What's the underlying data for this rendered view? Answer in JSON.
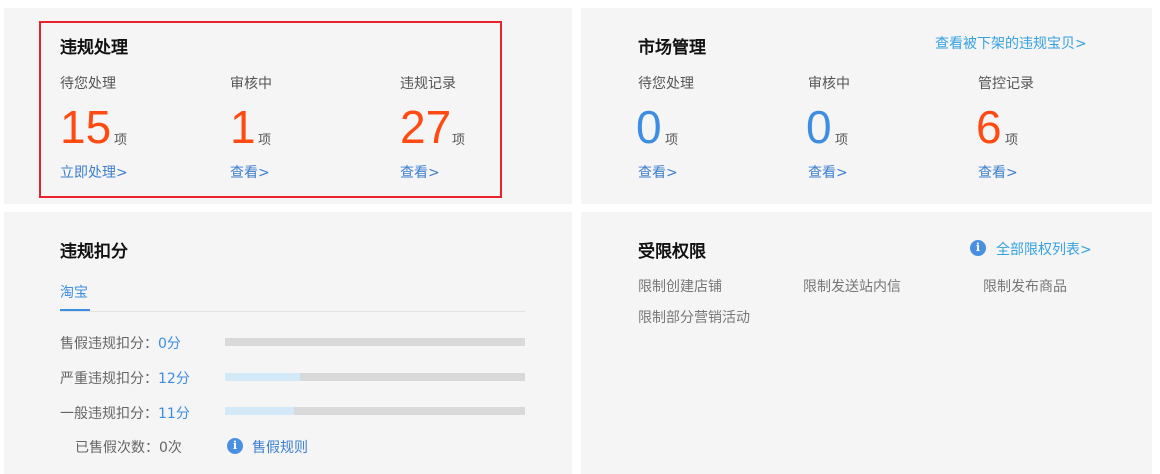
{
  "violation": {
    "title": "违规处理",
    "unit": "项",
    "stats": [
      {
        "label": "待您处理",
        "value": "15",
        "link": "立即处理>"
      },
      {
        "label": "审核中",
        "value": "1",
        "link": "查看>"
      },
      {
        "label": "违规记录",
        "value": "27",
        "link": "查看>"
      }
    ]
  },
  "market": {
    "title": "市场管理",
    "top_link": "查看被下架的违规宝贝>",
    "unit": "项",
    "stats": [
      {
        "label": "待您处理",
        "value": "0",
        "link": "查看>"
      },
      {
        "label": "审核中",
        "value": "0",
        "link": "查看>"
      },
      {
        "label": "管控记录",
        "value": "6",
        "link": "查看>"
      }
    ]
  },
  "deduct": {
    "title": "违规扣分",
    "tab": "淘宝",
    "rows": [
      {
        "label": "售假违规扣分：",
        "value": "0分",
        "fill": 0
      },
      {
        "label": "严重违规扣分：",
        "value": "12分",
        "fill": 0.25
      },
      {
        "label": "一般违规扣分：",
        "value": "11分",
        "fill": 0.23
      }
    ],
    "fake_count_label": "已售假次数：",
    "fake_count_value": "0次",
    "rule_link": "售假规则"
  },
  "restrict": {
    "title": "受限权限",
    "all_link": "全部限权列表>",
    "items": [
      "限制创建店铺",
      "限制发送站内信",
      "限制发布商品",
      "限制部分营销活动"
    ]
  },
  "colors": {
    "accent_red": "#ff4a12",
    "accent_blue": "#3d8de3",
    "highlight_border": "#e8232b"
  }
}
